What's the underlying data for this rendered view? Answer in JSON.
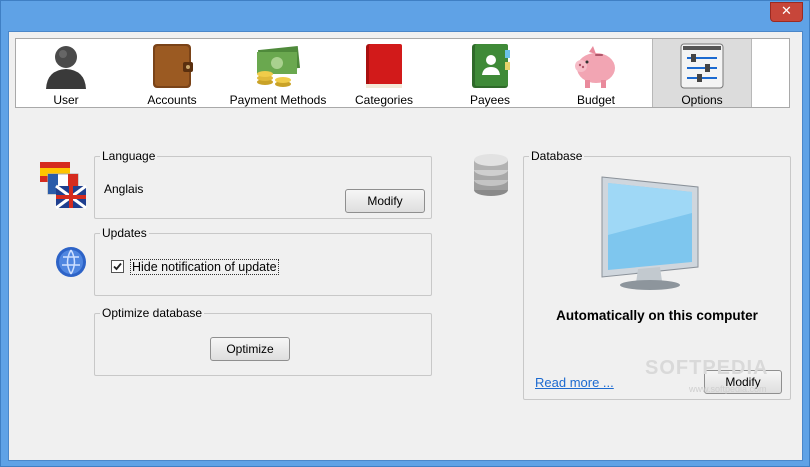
{
  "window": {
    "close_label": "✕"
  },
  "toolbar": {
    "items": [
      {
        "label": "User"
      },
      {
        "label": "Accounts"
      },
      {
        "label": "Payment Methods"
      },
      {
        "label": "Categories"
      },
      {
        "label": "Payees"
      },
      {
        "label": "Budget"
      },
      {
        "label": "Options"
      }
    ],
    "active": "Options"
  },
  "language": {
    "title": "Language",
    "value": "Anglais",
    "modify_label": "Modify"
  },
  "updates": {
    "title": "Updates",
    "checkbox_label": "Hide notification of update",
    "checked": true
  },
  "optimize": {
    "title": "Optimize database",
    "button_label": "Optimize"
  },
  "database": {
    "title": "Database",
    "status": "Automatically on this computer",
    "read_more": "Read more ...",
    "modify_label": "Modify"
  },
  "watermark": {
    "text": "SOFTPEDIA",
    "sub": "www.softpedia.com"
  }
}
